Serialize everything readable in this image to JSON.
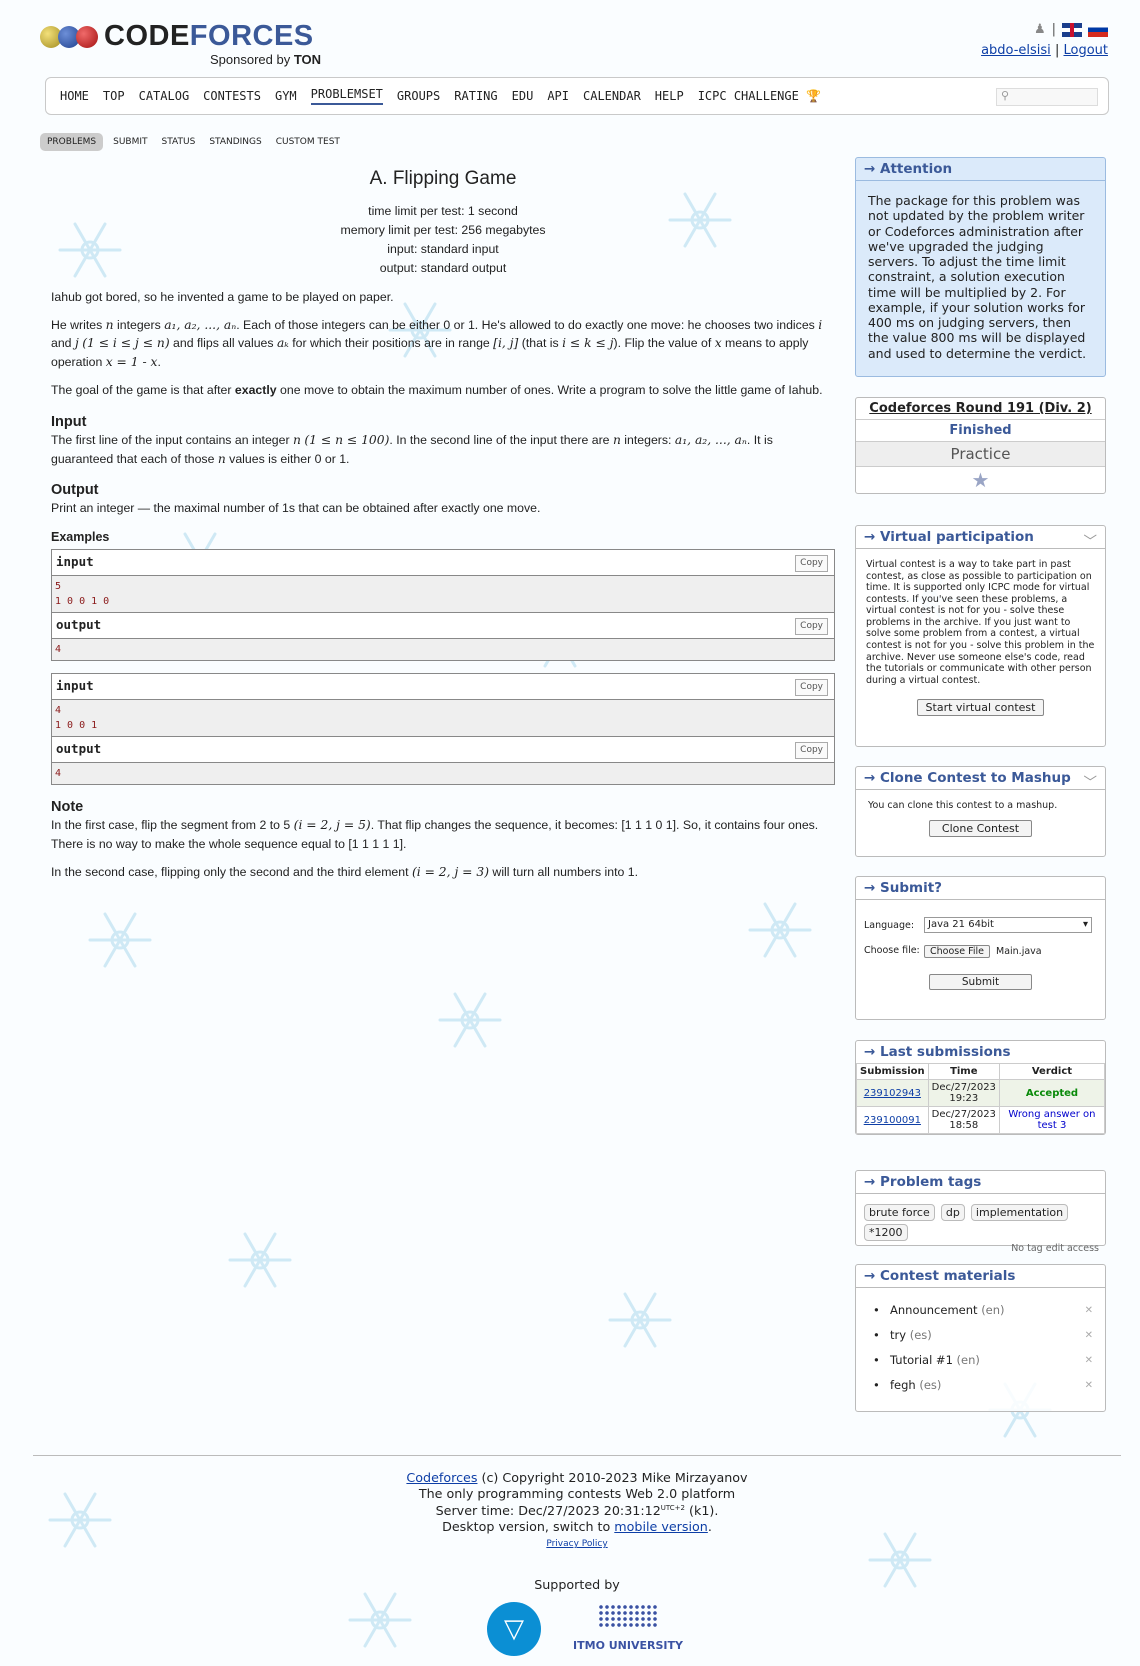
{
  "colors": {
    "accent": "#3b5998",
    "link": "#0d3ea6",
    "accepted": "#0a8a0a",
    "wrong": "#0000cc",
    "attention_bg": "#dbeafa"
  },
  "header": {
    "logo_part1": "CODE",
    "logo_part2": "FORCES",
    "sponsor_prefix": "Sponsored by ",
    "sponsor_name": "TON",
    "user": "abdo-elsisi",
    "sep": "|",
    "logout": "Logout"
  },
  "menu": [
    "HOME",
    "TOP",
    "CATALOG",
    "CONTESTS",
    "GYM",
    "PROBLEMSET",
    "GROUPS",
    "RATING",
    "EDU",
    "API",
    "CALENDAR",
    "HELP",
    "ICPC CHALLENGE"
  ],
  "subnav": [
    "PROBLEMS",
    "SUBMIT",
    "STATUS",
    "STANDINGS",
    "CUSTOM TEST"
  ],
  "problem": {
    "title": "A. Flipping Game",
    "time_limit": "time limit per test: 1 second",
    "memory_limit": "memory limit per test: 256 megabytes",
    "input": "input: standard input",
    "output": "output: standard output",
    "p1": "Iahub got bored, so he invented a game to be played on paper.",
    "p2a": "He writes ",
    "p2n": "n",
    "p2b": " integers ",
    "p2seq": "a₁, a₂, ..., aₙ",
    "p2c": ". Each of those integers can be either 0 or 1. He's allowed to do exactly one move: he chooses two indices ",
    "p2i": "i",
    "p2d": " and ",
    "p2j": "j",
    "p2e": " ",
    "p2range": "(1 ≤ i ≤ j ≤ n)",
    "p2f": " and flips all values ",
    "p2ak": "aₖ",
    "p2g": " for which their positions are in range ",
    "p2ij": "[i, j]",
    "p2h": " (that is ",
    "p2ikj": "i ≤ k ≤ j",
    "p2k": "). Flip the value of ",
    "p2x": "x",
    "p2l": " means to apply operation ",
    "p2op": "x = 1 - x",
    "p2m": ".",
    "p3a": "The goal of the game is that after ",
    "p3b": "exactly",
    "p3c": " one move to obtain the maximum number of ones. Write a program to solve the little game of Iahub.",
    "input_title": "Input",
    "in1": "The first line of the input contains an integer ",
    "in_n": "n",
    "in_rng": "(1 ≤ n ≤ 100)",
    "in2": ". In the second line of the input there are ",
    "in_n2": "n",
    "in3": " integers: ",
    "in_seq": "a₁, a₂, ..., aₙ",
    "in4": ". It is guaranteed that each of those ",
    "in_n3": "n",
    "in5": " values is either 0 or 1.",
    "output_title": "Output",
    "out": "Print an integer — the maximal number of 1s that can be obtained after exactly one move.",
    "examples_title": "Examples",
    "input_label": "input",
    "output_label": "output",
    "copy": "Copy",
    "ex1_in1": "5",
    "ex1_in2": "1 0 0 1 0",
    "ex1_out": "4",
    "ex2_in1": "4",
    "ex2_in2": "1 0 0 1",
    "ex2_out": "4",
    "note_title": "Note",
    "n1a": "In the first case, flip the segment from 2 to 5 ",
    "n1m": "(i = 2, j = 5)",
    "n1b": ". That flip changes the sequence, it becomes: [1 1 1 0 1]. So, it contains four ones. There is no way to make the whole sequence equal to [1 1 1 1 1].",
    "n2a": "In the second case, flipping only the second and the third element ",
    "n2m": "(i = 2, j = 3)",
    "n2b": " will turn all numbers into 1."
  },
  "sidebar": {
    "attention_title": "→ Attention",
    "attention_text": "The package for this problem was not updated by the problem writer or Codeforces administration after we've upgraded the judging servers. To adjust the time limit constraint, a solution execution time will be multiplied by 2. For example, if your solution works for 400 ms on judging servers, then the value 800 ms will be displayed and used to determine the verdict.",
    "round": "Codeforces Round 191 (Div. 2)",
    "finished": "Finished",
    "practice": "Practice",
    "vp_title": "→ Virtual participation",
    "vp_text": "Virtual contest is a way to take part in past contest, as close as possible to participation on time. It is supported only ICPC mode for virtual contests. If you've seen these problems, a virtual contest is not for you - solve these problems in the archive. If you just want to solve some problem from a contest, a virtual contest is not for you - solve this problem in the archive. Never use someone else's code, read the tutorials or communicate with other person during a virtual contest.",
    "vp_button": "Start virtual contest",
    "clone_title": "→ Clone Contest to Mashup",
    "clone_text": "You can clone this contest to a mashup.",
    "clone_button": "Clone Contest",
    "submit_title": "→ Submit?",
    "language_label": "Language:",
    "language_value": "Java 21 64bit",
    "file_label": "Choose file:",
    "file_button": "Choose File",
    "file_name": "Main.java",
    "submit_button": "Submit",
    "last_title": "→ Last submissions",
    "th_submission": "Submission",
    "th_time": "Time",
    "th_verdict": "Verdict",
    "rows": [
      {
        "id": "239102943",
        "date": "Dec/27/2023",
        "time": "19:23",
        "verdict": "Accepted"
      },
      {
        "id": "239100091",
        "date": "Dec/27/2023",
        "time": "18:58",
        "verdict": "Wrong answer on test 3"
      }
    ],
    "tags_title": "→ Problem tags",
    "tags": [
      "brute force",
      "dp",
      "implementation",
      "*1200"
    ],
    "tags_note": "No tag edit access",
    "materials_title": "→ Contest materials",
    "materials": [
      {
        "name": "Announcement",
        "lang": "(en)"
      },
      {
        "name": "try",
        "lang": "(es)"
      },
      {
        "name": "Tutorial #1",
        "lang": "(en)"
      },
      {
        "name": "fegh",
        "lang": "(es)"
      }
    ]
  },
  "footer": {
    "cf_link": "Codeforces",
    "line1": " (c) Copyright 2010-2023 Mike Mirzayanov",
    "line2": "The only programming contests Web 2.0 platform",
    "line3a": "Server time: Dec/27/2023 20:31:12",
    "line3tz": "UTC+2",
    "line3b": " (k1).",
    "line4a": "Desktop version, switch to ",
    "mobile": "mobile version",
    "privacy": "Privacy Policy",
    "supported": "Supported by",
    "itmo": "ITMO UNIVERSITY"
  }
}
